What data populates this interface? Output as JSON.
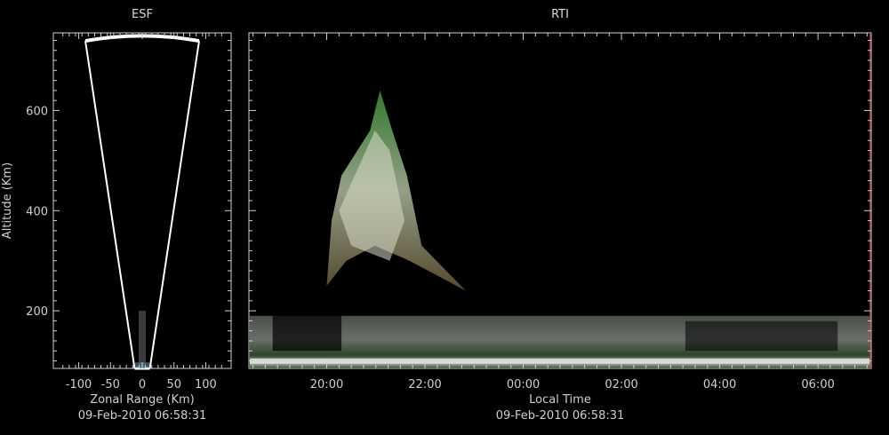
{
  "chart_data": [
    {
      "type": "scatter",
      "name_hint": "esf",
      "title": "ESF",
      "xlabel": "Zonal Range (Km)",
      "ylabel": "Altitude (Km)",
      "timestamp": "09-Feb-2010 06:58:31",
      "xlim": [
        -140,
        140
      ],
      "ylim": [
        85,
        755
      ],
      "xticks": [
        -100,
        -50,
        0,
        50,
        100
      ],
      "xtick_labels": [
        "-100",
        "-50",
        "0",
        "50",
        "100"
      ],
      "yticks": [
        200,
        400,
        600
      ],
      "ytick_labels": [
        "200",
        "400",
        "600"
      ],
      "fan": {
        "apex_altitude": 85,
        "top_altitude": 745,
        "half_angle_deg": 7.8
      },
      "echo": {
        "x": 0,
        "altitude_min": 85,
        "altitude_max": 200
      }
    },
    {
      "type": "heatmap",
      "name_hint": "rti",
      "title": "RTI",
      "xlabel": "Local Time",
      "ylabel": "",
      "timestamp": "09-Feb-2010 06:58:31",
      "xlim": [
        "18:25",
        "07:05"
      ],
      "ylim": [
        85,
        755
      ],
      "xticks": [
        "20:00",
        "22:00",
        "00:00",
        "02:00",
        "04:00",
        "06:00"
      ],
      "yticks": [
        200,
        400,
        600
      ],
      "plume": {
        "start_time": "20:00",
        "peak_time": "21:05",
        "end_time": "22:50",
        "peak_altitude": 640,
        "base_altitude": 250
      },
      "bottom_layer": {
        "altitude_min": 85,
        "altitude_max": 190
      }
    }
  ],
  "colors": {
    "background": "#000000",
    "text": "#cfcfcf",
    "frame": "#d0d0d0",
    "fan": "#ffffff",
    "echo_green": "#3fae3f",
    "right_edge": "#b04040"
  }
}
